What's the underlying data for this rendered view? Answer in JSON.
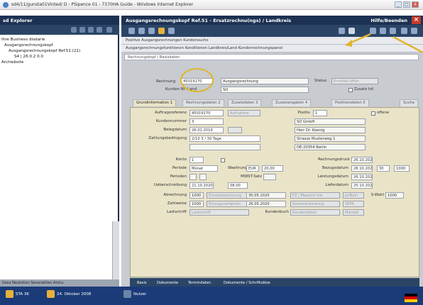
{
  "window": {
    "title": "sd4/11/gunsta01Vinted/ D - PSipence 01 - 7370HA Guide - Windows Internet Explorer",
    "btn_min": "_",
    "btn_max": "□",
    "btn_close": "X"
  },
  "left": {
    "header": "sd Explorer",
    "tree": [
      "Ihre Business disdarie",
      "Ausgangsrechnungskopf",
      "Ausgangsrechnungskopf Ref.51 (21)",
      "S4 | 26.0.2 0.0",
      "Archiebsite"
    ],
    "bottom": "Dosa  Neutotien  Senoraktien  Archu"
  },
  "main": {
    "header": "Ausgangsrechnungskopf Ref.51 - Ersatzrechnu(ngs) / Landkreis",
    "header_right": "Hilfe/Beenden",
    "strip1": "Positive  Ausgangsrechnungen  Kundensuche",
    "strip2": "Ausgangsrechnungsfunktionen  Konditionen  Landkreis/Land  Kundenrechnungspanel",
    "crumb": "Rechnungskopf / Basisdaten",
    "top_fields": {
      "rechnung_label": "Rechnung",
      "rechnung_value": "45019170",
      "type_value": "Ausgangsrechnung",
      "status_label": "Status",
      "status_value": "Ernstfall offen",
      "kunde_label": "Kunden Nr. Land",
      "kunde_value": "SO",
      "zusatz_label": "Zusatz Inf."
    },
    "tabs": [
      "Grundinformation 1",
      "Rechnungsdaten 2",
      "Zusatzdaten 3",
      "Zusatzangaben 4",
      "Positionsdaten 5",
      "Suche"
    ],
    "form": {
      "auftrag_label": "Auftragsreferenz",
      "auftrag_value": "45019170",
      "auftrag_status": "Aufnahme",
      "positiv_label": "Positiv",
      "positiv_value": "1",
      "offene_label": "offene",
      "kunde_label": "Kundennummer",
      "kunde_value": "3",
      "name_value": "SO GmbH",
      "datum_label": "Belegdatum",
      "datum_value": "26.01.2019",
      "name2_value": "Herr Dr. Koenig",
      "zahlung_label": "Zahlungsbedingung",
      "zahlung_value": "2/10 3 / 30 Tage",
      "adresse_value": "Strasse Musterweg 1",
      "ort_value": "DE-20354 Berlin",
      "konto_label": "Konto",
      "konto_value": "1",
      "rech_label": "Rechnungsdruck",
      "rech_value": "26.10.2020",
      "periode_label": "Periode",
      "periode_value": "Monat",
      "waehrung_label": "Waehrung",
      "waehrung_value": "EUR",
      "betrag1": "20,00",
      "bez_label": "Bezugsdatum",
      "bez_value": "26.10.2020",
      "bez2": "30",
      "bez3": "1000",
      "perioden_label": "Perioden",
      "mwst_label": "MWST-Satz",
      "leistung_label": "Leistungsdatum",
      "leistung_value": "26.10.2020",
      "ueber_label": "Ueberschreibung",
      "ueber_value": "21.10.2020",
      "ueber2": "08.00",
      "lieferdatum_label": "Lieferdatum",
      "liefer_value": "25.10.2020",
      "abrech_label": "Abrechnung",
      "abrech_value": "1000",
      "abrech2": "Einzelabrechnung",
      "abrech3": "30.05.2020",
      "abrech4": "FZ / Maestro frei",
      "abrech5": "Ja/Nein",
      "waehl_label": "S-Wahl",
      "waehl_value": "1000",
      "zahl_label": "Zahlweise",
      "zahl_value": "1000",
      "zahl2": "Einzugsverfahren",
      "zahl3": "26.05.2020",
      "zahl4": "Kontoverbindung",
      "zahl5": "SEPA",
      "lastsch_label": "Lastschrift",
      "lastsch_value": "Lastschrift",
      "kunden_label": "Kundenbuch",
      "kunden_value": "Kundendaten",
      "kunden2": "Mandat"
    },
    "bottom_tabs": [
      "Basis",
      "Dokumente",
      "Termindaten",
      "Dokumente / Schriftsätze"
    ]
  },
  "taskbar": {
    "start": "STA 36",
    "date": "24. Oktober 2008",
    "user": "Nutzer"
  },
  "colors": {
    "navy": "#1d3253",
    "highlight": "#e0b52a",
    "form_bg": "#e9e3c8"
  }
}
